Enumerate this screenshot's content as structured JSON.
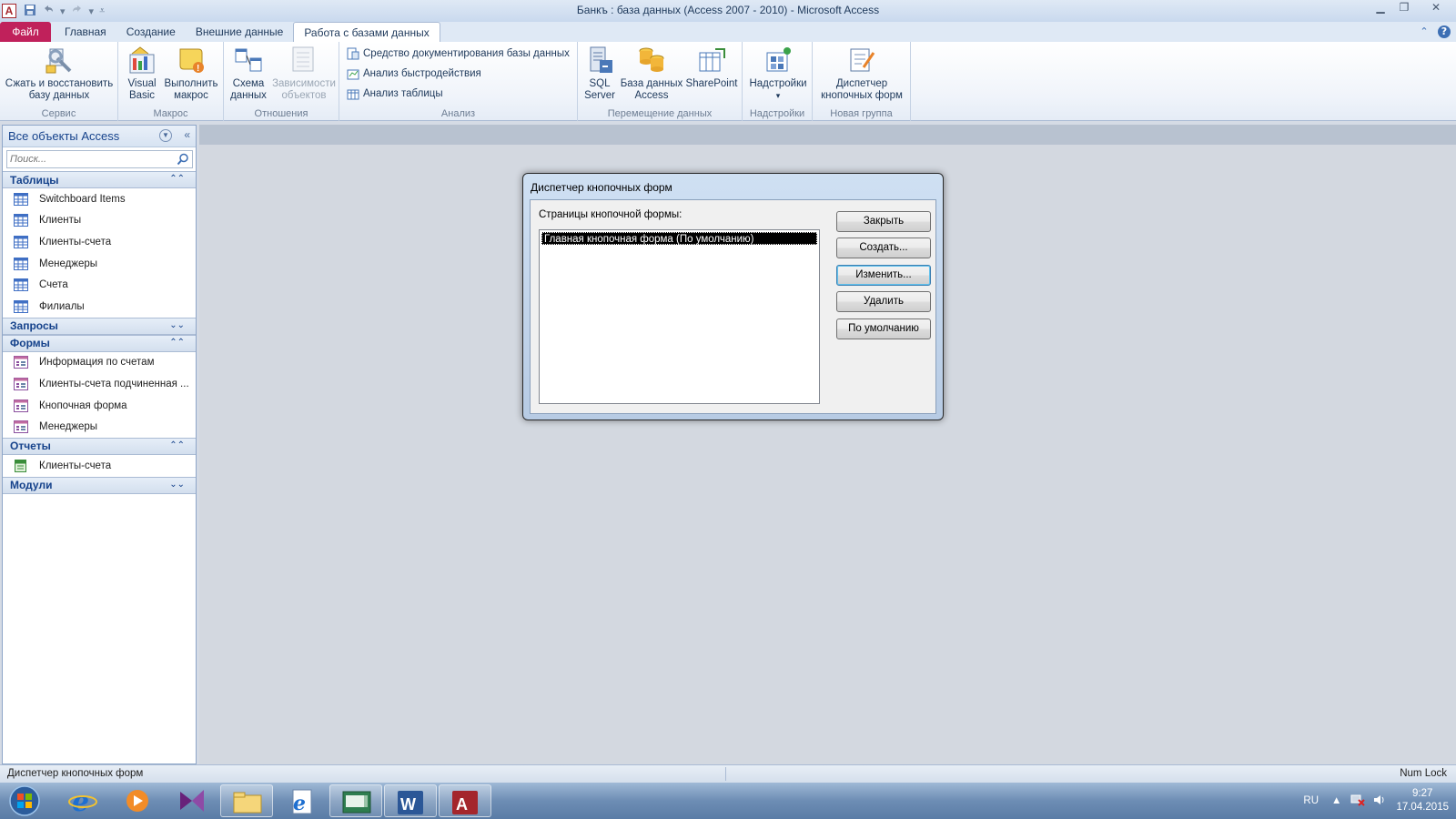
{
  "window": {
    "title": "Банкъ : база данных (Access 2007 - 2010)  -  Microsoft Access",
    "app_icon": "A",
    "controls": [
      "minimize-icon",
      "restore-icon",
      "close-icon"
    ]
  },
  "tabs": [
    {
      "label": "Файл",
      "kind": "file"
    },
    {
      "label": "Главная"
    },
    {
      "label": "Создание"
    },
    {
      "label": "Внешние данные"
    },
    {
      "label": "Работа с базами данных",
      "active": true
    }
  ],
  "ribbon": {
    "groups": {
      "service": {
        "label": "Сервис",
        "compact": {
          "line1": "Сжать и восстановить",
          "line2": "базу данных",
          "icon": "compact-repair-icon"
        }
      },
      "macro": {
        "label": "Макрос",
        "vb": {
          "line1": "Visual",
          "line2": "Basic",
          "icon": "visual-basic-icon"
        },
        "run": {
          "line1": "Выполнить",
          "line2": "макрос",
          "icon": "run-macro-icon"
        }
      },
      "relations": {
        "label": "Отношения",
        "schema": {
          "line1": "Схема",
          "line2": "данных",
          "icon": "relationships-icon"
        },
        "deps": {
          "line1": "Зависимости",
          "line2": "объектов",
          "icon": "object-dependencies-icon",
          "disabled": true
        }
      },
      "analysis": {
        "label": "Анализ",
        "items": [
          {
            "label": "Средство документирования базы данных",
            "icon": "documenter-icon"
          },
          {
            "label": "Анализ быстродействия",
            "icon": "performance-icon"
          },
          {
            "label": "Анализ таблицы",
            "icon": "table-analyzer-icon"
          }
        ]
      },
      "move": {
        "label": "Перемещение данных",
        "sql": {
          "line1": "SQL",
          "line2": "Server",
          "icon": "sql-server-icon"
        },
        "access": {
          "line1": "База данных",
          "line2": "Access",
          "icon": "access-database-icon"
        },
        "sharepoint": {
          "line1": "SharePoint",
          "line2": "",
          "icon": "sharepoint-icon"
        }
      },
      "addins": {
        "label": "Надстройки",
        "addins": {
          "line1": "Надстройки",
          "line2": "▾",
          "icon": "addins-icon"
        }
      },
      "newgroup": {
        "label": "Новая группа",
        "switchboard": {
          "line1": "Диспетчер",
          "line2": "кнопочных форм",
          "icon": "switchboard-manager-icon"
        }
      }
    }
  },
  "nav": {
    "title": "Все объекты Access",
    "search_placeholder": "Поиск...",
    "sections": {
      "tables": {
        "label": "Таблицы",
        "items": [
          "Switchboard Items",
          "Клиенты",
          "Клиенты-счета",
          "Менеджеры",
          "Счета",
          "Филиалы"
        ]
      },
      "queries": {
        "label": "Запросы"
      },
      "forms": {
        "label": "Формы",
        "items": [
          "Информация по счетам",
          "Клиенты-счета подчиненная ...",
          "Кнопочная форма",
          "Менеджеры"
        ]
      },
      "reports": {
        "label": "Отчеты",
        "items": [
          "Клиенты-счета"
        ]
      },
      "modules": {
        "label": "Модули"
      }
    }
  },
  "dialog": {
    "title": "Диспетчер кнопочных форм",
    "list_label": "Страницы кнопочной формы:",
    "selected_item": "Главная кнопочная форма (По умолчанию)",
    "buttons": {
      "close": "Закрыть",
      "create": "Создать...",
      "edit": "Изменить...",
      "delete": "Удалить",
      "default": "По умолчанию"
    }
  },
  "status": {
    "left": "Диспетчер кнопочных форм",
    "right": "Num Lock"
  },
  "taskbar": {
    "apps": [
      "start-orb-icon",
      "internet-explorer-icon",
      "media-player-icon",
      "visual-studio-icon",
      "file-explorer-icon",
      "ie-document-icon",
      "presentation-app-icon",
      "word-icon",
      "access-icon"
    ],
    "tray": {
      "lang": "RU",
      "time": "9:27",
      "date": "17.04.2015"
    }
  }
}
